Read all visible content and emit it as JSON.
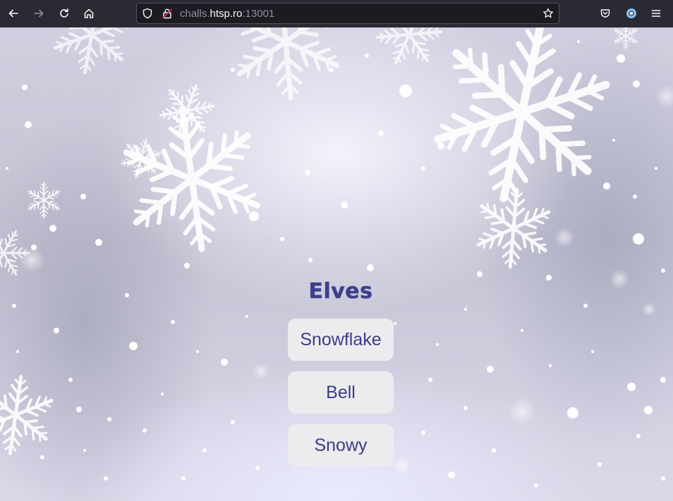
{
  "browser": {
    "url_prefix": "challs.",
    "url_host": "htsp.ro",
    "url_port": ":13001",
    "icons": {
      "back": "back-arrow-icon",
      "forward": "forward-arrow-icon",
      "reload": "reload-icon",
      "home": "home-icon",
      "tracking": "shield-icon",
      "insecure": "insecure-lock-icon",
      "bookmark": "star-icon",
      "pocket": "pocket-icon",
      "account": "account-icon",
      "menu": "hamburger-menu-icon"
    }
  },
  "page": {
    "title": "Elves",
    "choices": [
      {
        "label": "Snowflake"
      },
      {
        "label": "Bell"
      },
      {
        "label": "Snowy"
      }
    ],
    "colors": {
      "title": "#3d3f8a",
      "button_bg": "#ececee",
      "button_text": "#3b3d86"
    }
  }
}
